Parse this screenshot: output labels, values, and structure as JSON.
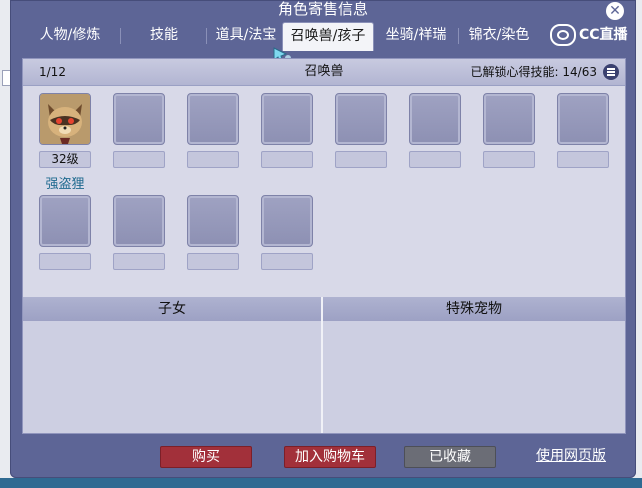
{
  "window": {
    "title": "角色寄售信息",
    "close_glyph": "✕"
  },
  "tabs": [
    {
      "label": "人物/修炼"
    },
    {
      "label": "技能"
    },
    {
      "label": "道具/法宝"
    },
    {
      "label": "召唤兽/孩子",
      "active": true
    },
    {
      "label": "坐骑/祥瑞"
    },
    {
      "label": "锦衣/染色"
    }
  ],
  "logo": {
    "text": "CC直播"
  },
  "summons": {
    "page": "1/12",
    "title": "召唤兽",
    "skills_unlocked": "已解锁心得技能: 14/63",
    "pets": [
      {
        "level": "32级",
        "name": "强盗狸",
        "filled": true
      },
      {
        "level": "",
        "name": "",
        "filled": false
      },
      {
        "level": "",
        "name": "",
        "filled": false
      },
      {
        "level": "",
        "name": "",
        "filled": false
      },
      {
        "level": "",
        "name": "",
        "filled": false
      },
      {
        "level": "",
        "name": "",
        "filled": false
      },
      {
        "level": "",
        "name": "",
        "filled": false
      },
      {
        "level": "",
        "name": "",
        "filled": false
      },
      {
        "level": "",
        "name": "",
        "filled": false
      },
      {
        "level": "",
        "name": "",
        "filled": false
      },
      {
        "level": "",
        "name": "",
        "filled": false
      },
      {
        "level": "",
        "name": "",
        "filled": false
      }
    ]
  },
  "lower": {
    "children_title": "子女",
    "special_pets_title": "特殊宠物"
  },
  "footer": {
    "buy": "购买",
    "add_to_cart": "加入购物车",
    "favorited": "已收藏",
    "web_version": "使用网页版"
  },
  "colors": {
    "window_bg": "#5d6596",
    "buy_button": "#a2303a",
    "favorited_button": "#6b6d76",
    "pet_name": "#1f6a8f"
  }
}
